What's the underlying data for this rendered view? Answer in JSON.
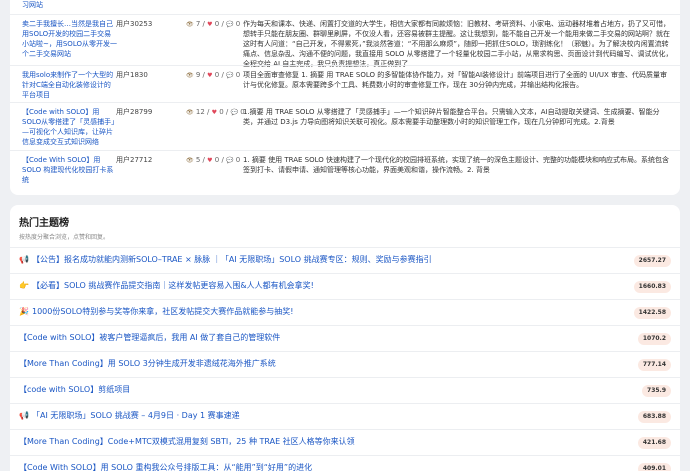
{
  "table": {
    "partial_top": "习网站",
    "rows": [
      {
        "title": "卖二手我擅长…当然是我自己用SOLO开发的校园二手交易小站啦~，用SOLO从零开发一个二手交易网站",
        "user": "用户30253",
        "views": "7",
        "likes": "0",
        "comments": "0",
        "desc": "作为每天和课本、快递、闲置打交道的大学生，相信大家都有同款烦恼：旧教材、考研资料、小家电、运动器材堆着占地方，扔了又可惜，想转手只能在朋友圈、群聊里刷屏，不仅没人看，还容易被群主提醒。这让我想到，能不能自己开发一个能用来做二手交易的网站啊？就在这时有人问道：“自己开发，不得累死，”我淡然答道：“不用那么麻烦”，随即一把抓住SOLO，琐割练化！（邪魅）。为了解决校内闲置流转痛点、信息杂乱、沟通不便的问题，我直接用 SOLO 从零搭建了一个轻量化校园二手小站，从需求构思、页面设计到代码编写、调试优化，全程交给 AI 自主完成，我只负责提想法，真正做到了"
      },
      {
        "title": "我用solo来制作了一个大型的针对C端全自动化装修设计的平台项目",
        "user": "用户1830",
        "views": "9",
        "likes": "0",
        "comments": "0",
        "desc": "项目全面审查修复 1. 摘要 用 TRAE SOLO 的多智能体协作能力，对「智能AI装修设计」前端项目进行了全面的 UI/UX 审查、代码质量审计与优化修复。原本需要跨多个工具、耗费数小时的审查修复工作，现在 30分钟内完成，并输出结构化报告。"
      },
      {
        "title": "【Code with SOLO】用SOLO从零搭建了「灵感捕手」—可视化个人知识库，让碎片信息变成交互式知识网络",
        "user": "用户28799",
        "views": "12",
        "likes": "0",
        "comments": "0",
        "desc": "1.摘要 用 TRAE SOLO 从零搭建了「灵感捕手」—一个知识碎片智能整合平台。只需输入文本，AI自动提取关键词、生成摘要、智能分类，并通过 D3.js 力导向图将知识关联可视化。原本需要手动整理数小时的知识管理工作，现在几分钟即可完成。2.背景"
      },
      {
        "title": "【Code With SOLO】用 SOLO 构建现代化校园打卡系统",
        "user": "用户27712",
        "views": "5",
        "likes": "0",
        "comments": "0",
        "desc": "1. 摘要 使用 TRAE SOLO 快速构建了一个现代化的校园排班系统，实现了统一的深色主题设计、完整的功能模块和响应式布局。系统包含签到打卡、请假申请、通知管理等核心功能，界面美观和谐，操作流畅。2. 背景"
      }
    ]
  },
  "hot": {
    "title": "热门主题榜",
    "subtitle": "按热度分聚合浏览，点赞和回复。",
    "topics": [
      {
        "icon": "📢",
        "title": "【公告】报名成功就能内测新SOLO–TRAE × 脉脉 ｜「AI 无限职场」SOLO 挑战赛专区：规则、奖励与参赛指引",
        "score": "2657.27"
      },
      {
        "icon": "👉",
        "title": "【必看】SOLO 挑战赛作品提交指南｜这样发帖更容易入围&人人都有机会拿奖!",
        "score": "1660.83"
      },
      {
        "icon": "🎉",
        "title": "1000份SOLO特别参与奖等你来拿，社区发帖提交大赛作品就能参与抽奖!",
        "score": "1422.58"
      },
      {
        "icon": "",
        "title": "【Code with SOLO】被客户管理逼疯后，我用 AI 做了套自己的管理软件",
        "score": "1070.2"
      },
      {
        "icon": "",
        "title": "【More Than Coding】用 SOLO 3分钟生成开发非遗绒花海外推广系统",
        "score": "777.14"
      },
      {
        "icon": "",
        "title": "【code with SOLO】剪纸项目",
        "score": "735.9"
      },
      {
        "icon": "📢",
        "title": "「AI 无限职场」SOLO 挑战赛 – 4月9日 · Day 1 赛事速递",
        "score": "683.88"
      },
      {
        "icon": "",
        "title": "【More Than Coding】Code+MTC双模式混用复刻 SBTI，25 种 TRAE 社区人格等你来认领",
        "score": "421.68"
      },
      {
        "icon": "",
        "title": "【Code With SOLO】用 SOLO 重构我公众号排版工具：从“能用”到“好用”的进化",
        "score": "409.01"
      }
    ]
  }
}
